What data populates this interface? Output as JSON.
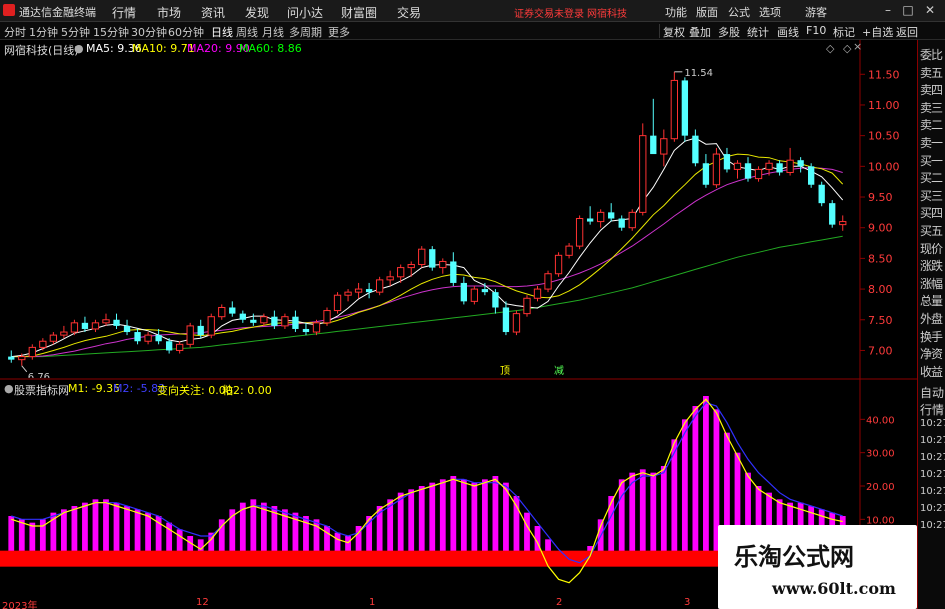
{
  "titlebar": {
    "app_title": "通达信金融终端",
    "menus": [
      "行情",
      "市场",
      "资讯",
      "发现",
      "问小达",
      "财富圈",
      "交易"
    ],
    "notice": "证券交易未登录",
    "brand": "网宿科技",
    "right_items": [
      "功能",
      "版面",
      "公式",
      "选项"
    ],
    "right_tool": "游客"
  },
  "toolbar": {
    "periods": [
      "分时",
      "1分钟",
      "5分钟",
      "15分钟",
      "30分钟",
      "60分钟",
      "日线",
      "周线",
      "月线",
      "多周期",
      "更多"
    ],
    "active_period": "日线",
    "buttons": [
      "复权",
      "叠加",
      "多股",
      "统计",
      "画线",
      "F10",
      "标记",
      "+自选",
      "返回"
    ]
  },
  "main_legend": {
    "stock": "网宿科技(日线)",
    "ma5": "MA5: 9.36",
    "ma10": "MA10: 9.71",
    "ma20": "MA20: 9.90",
    "ma60": "MA60: 8.86",
    "colors": {
      "ma5": "#ffffff",
      "ma10": "#ffff00",
      "ma20": "#ff00ff",
      "ma60": "#00ff00"
    }
  },
  "price_axis": {
    "ticks": [
      "11.50",
      "11.00",
      "10.50",
      "10.00",
      "9.50",
      "9.00",
      "8.50",
      "8.00",
      "7.50",
      "7.00"
    ],
    "high_label": "11.54",
    "low_label": "6.76"
  },
  "signals": {
    "buy": "顶",
    "sell": "减"
  },
  "sidepanel": [
    "委比",
    "卖五",
    "卖四",
    "卖三",
    "卖二",
    "卖一",
    "买一",
    "买二",
    "买三",
    "买四",
    "买五",
    "现价",
    "涨跌",
    "涨幅",
    "总量",
    "外盘",
    "换手",
    "净资",
    "收益"
  ],
  "sidepanel2": [
    "自动",
    "行情",
    "10:27",
    "10:27",
    "10:27",
    "10:27",
    "10:27",
    "10:27",
    "10:27"
  ],
  "indicator_legend": {
    "name": "股票指标网",
    "m1": "M1: -9.35",
    "m2": "M2: -5.83",
    "focus": "变向关注: 0.00",
    "stick": "粘2: 0.00"
  },
  "indicator_axis": {
    "ticks": [
      "40.00",
      "30.00",
      "20.00",
      "10.00"
    ]
  },
  "xaxis": {
    "labels": [
      "2023年",
      "12",
      "1",
      "2",
      "3"
    ]
  },
  "watermark": {
    "line1": "乐淘公式网",
    "line2": "www.60lt.com"
  },
  "chart_data": {
    "type": "candlestick",
    "ylim": [
      6.6,
      11.7
    ],
    "candles": [
      [
        6.9,
        7.0,
        6.8,
        6.85
      ],
      [
        6.85,
        6.95,
        6.75,
        6.9
      ],
      [
        6.9,
        7.1,
        6.85,
        7.05
      ],
      [
        7.05,
        7.2,
        7.0,
        7.15
      ],
      [
        7.15,
        7.3,
        7.1,
        7.25
      ],
      [
        7.25,
        7.4,
        7.2,
        7.3
      ],
      [
        7.3,
        7.5,
        7.25,
        7.45
      ],
      [
        7.45,
        7.55,
        7.3,
        7.35
      ],
      [
        7.35,
        7.5,
        7.3,
        7.45
      ],
      [
        7.45,
        7.6,
        7.4,
        7.5
      ],
      [
        7.5,
        7.6,
        7.35,
        7.4
      ],
      [
        7.4,
        7.5,
        7.25,
        7.3
      ],
      [
        7.3,
        7.35,
        7.1,
        7.15
      ],
      [
        7.15,
        7.3,
        7.1,
        7.25
      ],
      [
        7.25,
        7.35,
        7.1,
        7.15
      ],
      [
        7.15,
        7.2,
        6.95,
        7.0
      ],
      [
        7.0,
        7.15,
        6.95,
        7.1
      ],
      [
        7.1,
        7.45,
        7.05,
        7.4
      ],
      [
        7.4,
        7.5,
        7.2,
        7.25
      ],
      [
        7.25,
        7.6,
        7.2,
        7.55
      ],
      [
        7.55,
        7.75,
        7.5,
        7.7
      ],
      [
        7.7,
        7.8,
        7.55,
        7.6
      ],
      [
        7.6,
        7.65,
        7.45,
        7.5
      ],
      [
        7.5,
        7.6,
        7.4,
        7.45
      ],
      [
        7.45,
        7.6,
        7.4,
        7.55
      ],
      [
        7.55,
        7.65,
        7.35,
        7.4
      ],
      [
        7.4,
        7.6,
        7.35,
        7.55
      ],
      [
        7.55,
        7.65,
        7.3,
        7.35
      ],
      [
        7.35,
        7.45,
        7.25,
        7.3
      ],
      [
        7.3,
        7.5,
        7.25,
        7.45
      ],
      [
        7.45,
        7.7,
        7.4,
        7.65
      ],
      [
        7.65,
        7.95,
        7.6,
        7.9
      ],
      [
        7.9,
        8.0,
        7.8,
        7.95
      ],
      [
        7.95,
        8.1,
        7.85,
        8.0
      ],
      [
        8.0,
        8.1,
        7.85,
        7.95
      ],
      [
        7.95,
        8.2,
        7.9,
        8.15
      ],
      [
        8.15,
        8.3,
        8.05,
        8.2
      ],
      [
        8.2,
        8.4,
        8.1,
        8.35
      ],
      [
        8.35,
        8.45,
        8.2,
        8.4
      ],
      [
        8.4,
        8.7,
        8.35,
        8.65
      ],
      [
        8.65,
        8.7,
        8.3,
        8.35
      ],
      [
        8.35,
        8.5,
        8.25,
        8.45
      ],
      [
        8.45,
        8.6,
        8.05,
        8.1
      ],
      [
        8.1,
        8.2,
        7.75,
        7.8
      ],
      [
        7.8,
        8.05,
        7.75,
        8.0
      ],
      [
        8.0,
        8.1,
        7.9,
        7.95
      ],
      [
        7.95,
        8.0,
        7.6,
        7.7
      ],
      [
        7.7,
        7.8,
        7.25,
        7.3
      ],
      [
        7.3,
        7.65,
        7.25,
        7.6
      ],
      [
        7.6,
        7.9,
        7.55,
        7.85
      ],
      [
        7.85,
        8.05,
        7.8,
        8.0
      ],
      [
        8.0,
        8.3,
        7.95,
        8.25
      ],
      [
        8.25,
        8.6,
        8.2,
        8.55
      ],
      [
        8.55,
        8.75,
        8.5,
        8.7
      ],
      [
        8.7,
        9.2,
        8.65,
        9.15
      ],
      [
        9.15,
        9.35,
        9.05,
        9.1
      ],
      [
        9.1,
        9.3,
        9.0,
        9.25
      ],
      [
        9.25,
        9.4,
        9.1,
        9.15
      ],
      [
        9.15,
        9.2,
        8.95,
        9.0
      ],
      [
        9.0,
        9.3,
        8.95,
        9.25
      ],
      [
        9.25,
        10.7,
        9.2,
        10.5
      ],
      [
        10.5,
        11.1,
        10.3,
        10.2
      ],
      [
        10.2,
        10.6,
        10.0,
        10.45
      ],
      [
        10.45,
        11.54,
        10.4,
        11.4
      ],
      [
        11.4,
        11.45,
        10.4,
        10.5
      ],
      [
        10.5,
        10.6,
        10.0,
        10.05
      ],
      [
        10.05,
        10.2,
        9.65,
        9.7
      ],
      [
        9.7,
        10.3,
        9.65,
        10.2
      ],
      [
        10.2,
        10.3,
        9.9,
        9.95
      ],
      [
        9.95,
        10.1,
        9.8,
        10.05
      ],
      [
        10.05,
        10.15,
        9.75,
        9.8
      ],
      [
        9.8,
        10.0,
        9.75,
        9.95
      ],
      [
        9.95,
        10.1,
        9.85,
        10.05
      ],
      [
        10.05,
        10.1,
        9.85,
        9.9
      ],
      [
        9.9,
        10.3,
        9.85,
        10.1
      ],
      [
        10.1,
        10.15,
        9.9,
        10.0
      ],
      [
        10.0,
        10.05,
        9.65,
        9.7
      ],
      [
        9.7,
        9.75,
        9.35,
        9.4
      ],
      [
        9.4,
        9.45,
        9.0,
        9.05
      ],
      [
        9.05,
        9.2,
        8.95,
        9.1
      ]
    ],
    "ma5": [
      6.9,
      6.92,
      6.96,
      7.03,
      7.1,
      7.19,
      7.28,
      7.32,
      7.36,
      7.41,
      7.43,
      7.4,
      7.36,
      7.32,
      7.25,
      7.17,
      7.14,
      7.18,
      7.2,
      7.26,
      7.4,
      7.49,
      7.52,
      7.56,
      7.56,
      7.5,
      7.49,
      7.48,
      7.44,
      7.42,
      7.47,
      7.56,
      7.69,
      7.84,
      7.94,
      8.0,
      8.05,
      8.13,
      8.22,
      8.35,
      8.39,
      8.4,
      8.39,
      8.35,
      8.14,
      8.06,
      7.93,
      7.76,
      7.73,
      7.71,
      7.69,
      7.8,
      8.05,
      8.27,
      8.52,
      8.75,
      8.96,
      9.11,
      9.13,
      9.15,
      9.43,
      9.66,
      9.95,
      10.26,
      10.41,
      10.46,
      10.36,
      10.37,
      10.1,
      9.99,
      9.96,
      9.93,
      9.99,
      9.95,
      10.0,
      10.0,
      9.92,
      9.83,
      9.65,
      9.45
    ],
    "ma10": [
      6.9,
      6.9,
      6.91,
      6.95,
      7.0,
      7.05,
      7.11,
      7.16,
      7.2,
      7.23,
      7.28,
      7.33,
      7.34,
      7.34,
      7.33,
      7.3,
      7.27,
      7.26,
      7.24,
      7.26,
      7.29,
      7.31,
      7.35,
      7.38,
      7.41,
      7.44,
      7.45,
      7.45,
      7.45,
      7.45,
      7.44,
      7.49,
      7.55,
      7.62,
      7.67,
      7.73,
      7.81,
      7.9,
      8.0,
      8.09,
      8.16,
      8.21,
      8.24,
      8.23,
      8.19,
      8.17,
      8.12,
      8.04,
      7.97,
      7.92,
      7.87,
      7.86,
      7.89,
      7.97,
      8.07,
      8.2,
      8.34,
      8.49,
      8.66,
      8.83,
      9.02,
      9.21,
      9.36,
      9.54,
      9.7,
      9.87,
      10.0,
      10.08,
      10.16,
      10.2,
      10.19,
      10.15,
      10.14,
      10.09,
      10.07,
      10.04,
      9.99,
      9.96,
      9.89,
      9.71
    ],
    "ma20": [
      6.9,
      6.9,
      6.9,
      6.91,
      6.93,
      6.96,
      6.99,
      7.03,
      7.07,
      7.11,
      7.14,
      7.18,
      7.21,
      7.23,
      7.25,
      7.26,
      7.27,
      7.28,
      7.29,
      7.31,
      7.33,
      7.35,
      7.37,
      7.38,
      7.39,
      7.4,
      7.41,
      7.43,
      7.45,
      7.47,
      7.5,
      7.54,
      7.58,
      7.63,
      7.68,
      7.73,
      7.79,
      7.85,
      7.9,
      7.95,
      7.99,
      8.02,
      8.04,
      8.05,
      8.05,
      8.05,
      8.05,
      8.04,
      8.04,
      8.05,
      8.07,
      8.1,
      8.15,
      8.2,
      8.26,
      8.33,
      8.41,
      8.5,
      8.6,
      8.7,
      8.82,
      8.94,
      9.06,
      9.19,
      9.31,
      9.43,
      9.53,
      9.62,
      9.7,
      9.76,
      9.81,
      9.85,
      9.89,
      9.92,
      9.95,
      9.97,
      9.98,
      9.97,
      9.95,
      9.9
    ],
    "ma60": [
      6.9,
      6.9,
      6.9,
      6.9,
      6.91,
      6.92,
      6.93,
      6.94,
      6.95,
      6.96,
      6.97,
      6.98,
      6.99,
      7.0,
      7.01,
      7.02,
      7.03,
      7.04,
      7.05,
      7.07,
      7.09,
      7.11,
      7.13,
      7.15,
      7.17,
      7.19,
      7.21,
      7.23,
      7.25,
      7.27,
      7.29,
      7.31,
      7.33,
      7.35,
      7.37,
      7.39,
      7.41,
      7.43,
      7.45,
      7.47,
      7.49,
      7.51,
      7.53,
      7.55,
      7.57,
      7.59,
      7.61,
      7.63,
      7.65,
      7.67,
      7.7,
      7.73,
      7.76,
      7.79,
      7.82,
      7.86,
      7.9,
      7.94,
      7.98,
      8.02,
      8.07,
      8.12,
      8.17,
      8.22,
      8.27,
      8.32,
      8.37,
      8.42,
      8.47,
      8.52,
      8.56,
      8.6,
      8.64,
      8.68,
      8.71,
      8.74,
      8.77,
      8.8,
      8.83,
      8.86
    ],
    "indicator": {
      "ylim": [
        -13,
        47
      ],
      "bars": [
        11,
        10,
        9,
        10,
        12,
        13,
        14,
        15,
        16,
        16,
        15,
        14,
        13,
        12,
        11,
        9,
        7,
        5,
        4,
        6,
        10,
        13,
        15,
        16,
        15,
        14,
        13,
        12,
        11,
        10,
        8,
        6,
        5,
        8,
        11,
        14,
        16,
        18,
        19,
        20,
        21,
        22,
        23,
        22,
        21,
        22,
        23,
        21,
        17,
        12,
        8,
        4,
        -2,
        -4,
        -2,
        2,
        10,
        17,
        22,
        24,
        25,
        24,
        26,
        34,
        40,
        44,
        47,
        43,
        36,
        30,
        24,
        20,
        18,
        16,
        15,
        15,
        14,
        13,
        12,
        11
      ],
      "m1": [
        10,
        9,
        8,
        8,
        10,
        12,
        13,
        14,
        15,
        15,
        14,
        13,
        12,
        11,
        9,
        7,
        5,
        3,
        1,
        4,
        8,
        11,
        13,
        14,
        13,
        12,
        11,
        10,
        9,
        8,
        6,
        4,
        3,
        6,
        10,
        13,
        15,
        17,
        18,
        19,
        20,
        21,
        22,
        21,
        20,
        21,
        22,
        19,
        14,
        8,
        3,
        -4,
        -8,
        -9,
        -6,
        -1,
        8,
        15,
        21,
        23,
        24,
        23,
        25,
        33,
        39,
        43,
        46,
        42,
        35,
        29,
        23,
        19,
        17,
        15,
        14,
        13,
        12,
        11,
        10,
        9.35
      ],
      "m2": [
        11,
        10,
        10,
        10,
        11,
        12,
        13,
        14,
        15,
        15,
        15,
        14,
        13,
        12,
        11,
        9,
        7,
        6,
        5,
        5,
        8,
        11,
        13,
        14,
        14,
        13,
        12,
        11,
        10,
        9,
        8,
        6,
        5,
        6,
        9,
        12,
        14,
        16,
        18,
        19,
        20,
        21,
        22,
        22,
        21,
        21,
        21,
        20,
        17,
        13,
        9,
        5,
        1,
        -2,
        -3,
        -1,
        5,
        11,
        17,
        21,
        23,
        23,
        24,
        30,
        36,
        41,
        45,
        44,
        39,
        33,
        28,
        24,
        21,
        18,
        16,
        15,
        14,
        13,
        12,
        11
      ]
    }
  }
}
